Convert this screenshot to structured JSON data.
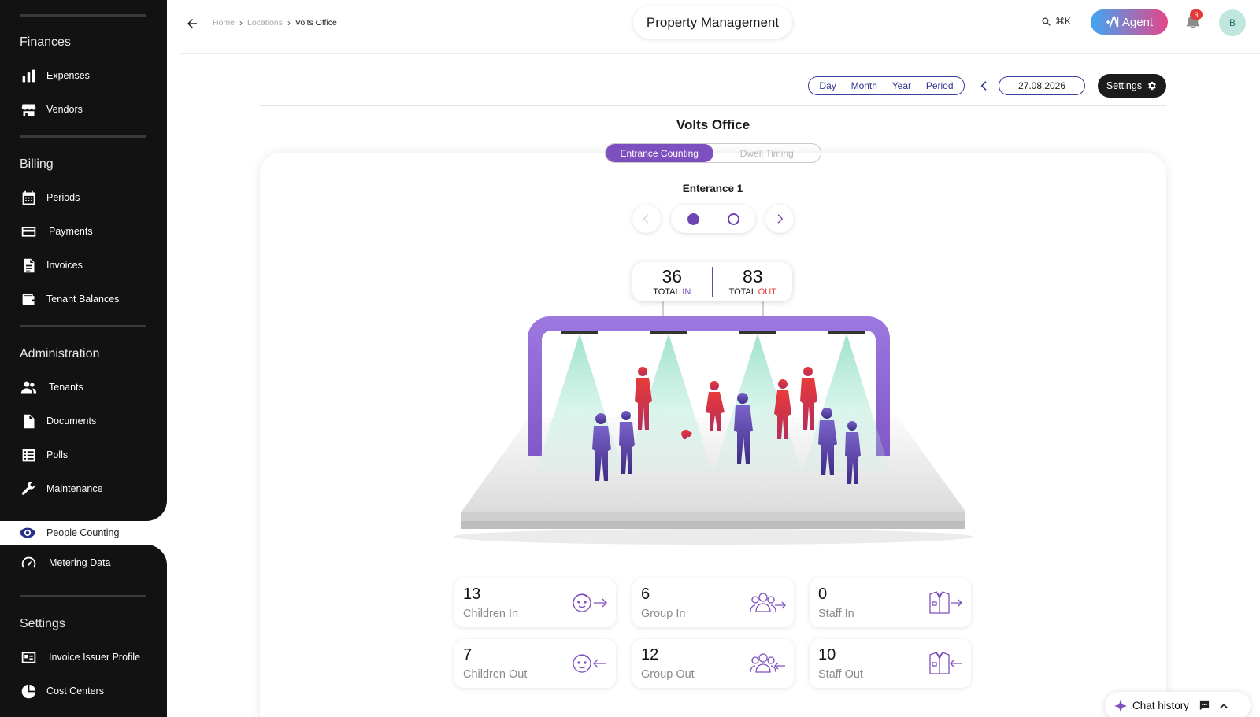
{
  "sidebar": {
    "sections": [
      {
        "heading": "Finances",
        "items": [
          {
            "label": "Expenses",
            "icon": "bar-chart-icon"
          },
          {
            "label": "Vendors",
            "icon": "store-icon"
          }
        ]
      },
      {
        "heading": "Billing",
        "items": [
          {
            "label": "Periods",
            "icon": "calendar-icon"
          },
          {
            "label": "Payments",
            "icon": "credit-card-icon"
          },
          {
            "label": "Invoices",
            "icon": "document-icon"
          },
          {
            "label": "Tenant Balances",
            "icon": "wallet-icon"
          }
        ]
      },
      {
        "heading": "Administration",
        "items": [
          {
            "label": "Tenants",
            "icon": "people-icon"
          },
          {
            "label": "Documents",
            "icon": "file-icon"
          },
          {
            "label": "Polls",
            "icon": "checklist-icon"
          },
          {
            "label": "Maintenance",
            "icon": "wrench-icon"
          }
        ]
      }
    ],
    "active_item": {
      "label": "People Counting",
      "icon": "eye-icon"
    },
    "after_active": {
      "label": "Metering Data",
      "icon": "gauge-icon"
    },
    "settings_section": {
      "heading": "Settings",
      "items": [
        {
          "label": "Invoice Issuer Profile",
          "icon": "id-card-icon"
        },
        {
          "label": "Cost Centers",
          "icon": "pie-chart-icon"
        }
      ]
    }
  },
  "topbar": {
    "breadcrumb": [
      "Home",
      "Locations",
      "Volts Office"
    ],
    "title": "Property Management",
    "search_shortcut": "⌘K",
    "agent_label": "Agent",
    "notification_count": "3",
    "avatar_initial": "B"
  },
  "controls": {
    "period_options": [
      "Day",
      "Month",
      "Year",
      "Period"
    ],
    "date": "27.08.2026",
    "settings_label": "Settings"
  },
  "location": {
    "title": "Volts Office",
    "tabs": [
      {
        "label": "Entrance Counting",
        "active": true
      },
      {
        "label": "Dwell Timing",
        "active": false
      }
    ],
    "entrance_label": "Enterance 1",
    "pages": 2,
    "current_page": 1
  },
  "totals": {
    "in_value": "36",
    "in_prefix": "TOTAL ",
    "in_word": "IN",
    "out_value": "83",
    "out_prefix": "TOTAL ",
    "out_word": "OUT"
  },
  "stats": [
    {
      "value": "13",
      "label": "Children In",
      "icon": "child-in-icon"
    },
    {
      "value": "6",
      "label": "Group In",
      "icon": "group-in-icon"
    },
    {
      "value": "0",
      "label": "Staff In",
      "icon": "staff-in-icon"
    },
    {
      "value": "7",
      "label": "Children Out",
      "icon": "child-out-icon"
    },
    {
      "value": "12",
      "label": "Group Out",
      "icon": "group-out-icon"
    },
    {
      "value": "10",
      "label": "Staff Out",
      "icon": "staff-out-icon"
    }
  ],
  "chat": {
    "label": "Chat history"
  },
  "colors": {
    "accent": "#7e4fbe",
    "out": "#e23b3b",
    "sidebar": "#121212",
    "navy": "#2f3493"
  }
}
